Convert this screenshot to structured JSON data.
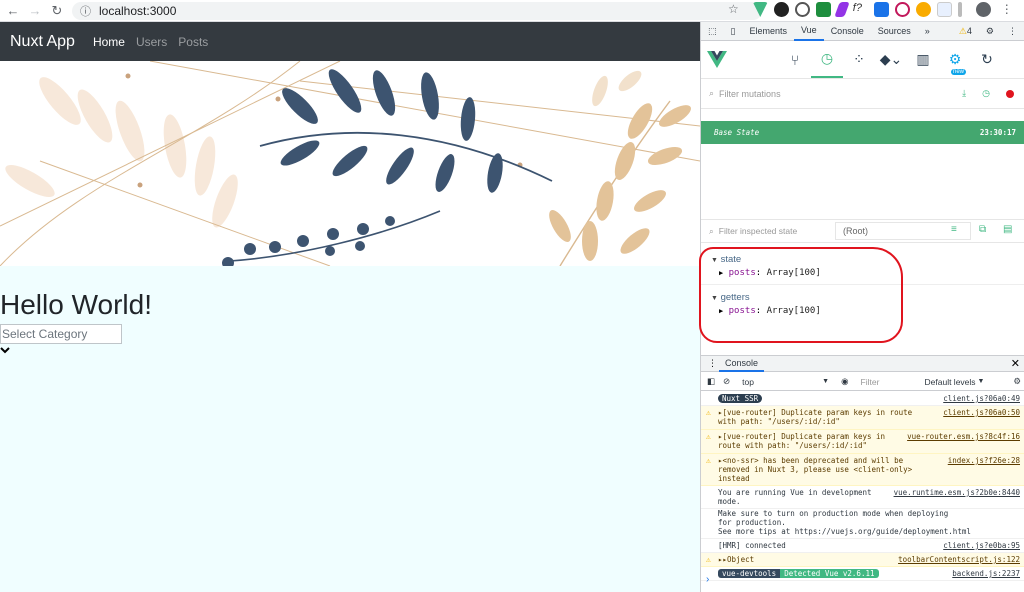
{
  "browser": {
    "url": "localhost:3000"
  },
  "app": {
    "brand": "Nuxt App",
    "nav": [
      "Home",
      "Users",
      "Posts"
    ],
    "heading": "Hello World!",
    "select_placeholder": "Select Category"
  },
  "devtools": {
    "tabs": [
      "Elements",
      "Vue",
      "Console",
      "Sources"
    ],
    "warnings_count": "4",
    "vue_new_badge": "new",
    "filter_mutations": "Filter mutations",
    "base_state_label": "Base State",
    "base_state_time": "23:30:17",
    "filter_state": "Filter inspected state",
    "root": "(Root)",
    "state_label": "state",
    "getters_label": "getters",
    "state_prop_key": "posts",
    "state_prop_val": "Array[100]",
    "getters_prop_key": "posts",
    "getters_prop_val": "Array[100]"
  },
  "console": {
    "tab": "Console",
    "context": "top",
    "filter": "Filter",
    "levels": "Default levels",
    "logs": [
      {
        "kind": "badge",
        "badge": "Nuxt SSR",
        "badge_color": "#2c3e50",
        "text": "",
        "src": "client.js?06a0:49"
      },
      {
        "kind": "warn",
        "text": "▸[vue-router] Duplicate param keys in route with path: \"/users/:id/:id\"",
        "src": "client.js?06a0:50"
      },
      {
        "kind": "warn",
        "text": "▸[vue-router] Duplicate param keys in route with path: \"/users/:id/:id\"",
        "src": "vue-router.esm.js?8c4f:16"
      },
      {
        "kind": "warn",
        "text": "▸<no-ssr> has been deprecated and will be removed in Nuxt 3, please use <client-only> instead",
        "src": "index.js?f26e:28"
      },
      {
        "kind": "info",
        "text": "You are running Vue in development mode.",
        "src": "vue.runtime.esm.js?2b0e:8440"
      },
      {
        "kind": "info",
        "text": "Make sure to turn on production mode when deploying for production.",
        "src": ""
      },
      {
        "kind": "info",
        "text": "See more tips at https://vuejs.org/guide/deployment.html",
        "src": ""
      },
      {
        "kind": "info",
        "text": "[HMR] connected",
        "src": "client.js?e0ba:95"
      },
      {
        "kind": "warn",
        "text": "▸▸Object",
        "src": "toolbarContentscript.js:122"
      },
      {
        "kind": "badge2",
        "badge": "vue-devtools",
        "badge_color": "#35495e",
        "badge2": "Detected Vue v2.6.11",
        "badge2_color": "#41b883",
        "text": "",
        "src": "backend.js:2237"
      }
    ]
  },
  "colors": {
    "navbar": "#343a40",
    "page_bg": "#f0feff",
    "vue_green": "#41b883",
    "annotation_red": "#e0141e"
  }
}
